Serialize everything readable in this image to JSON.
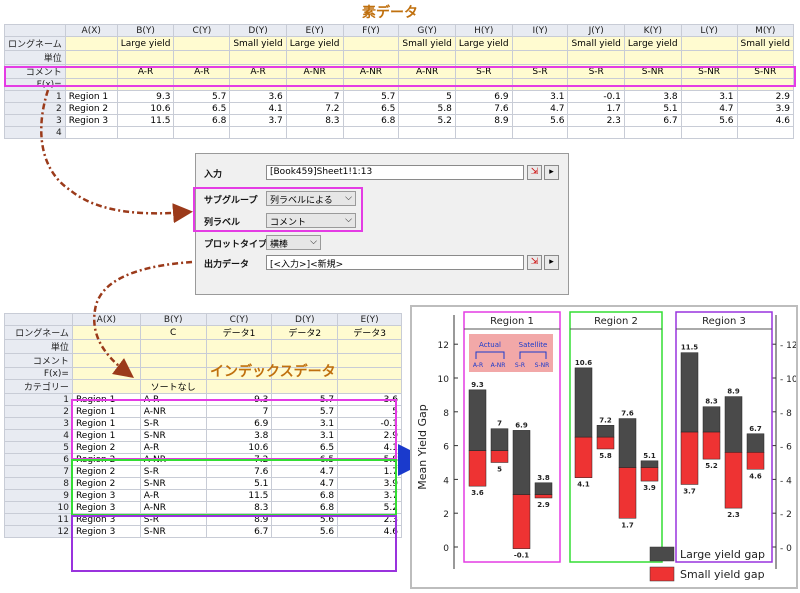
{
  "top_title": "素データ",
  "index_title": "インデックスデータ",
  "top_sheet": {
    "headers": [
      "",
      "A(X)",
      "B(Y)",
      "C(Y)",
      "D(Y)",
      "E(Y)",
      "F(Y)",
      "G(Y)",
      "H(Y)",
      "I(Y)",
      "J(Y)",
      "K(Y)",
      "L(Y)",
      "M(Y)"
    ],
    "longname": [
      "ロングネーム",
      "",
      "Large yield",
      "",
      "Small yield",
      "Large yield",
      "",
      "Small yield",
      "Large yield",
      "",
      "Small yield",
      "Large yield",
      "",
      "Small yield"
    ],
    "units": [
      "単位",
      "",
      "",
      "",
      "",
      "",
      "",
      "",
      "",
      "",
      "",
      "",
      "",
      ""
    ],
    "comments": [
      "コメント",
      "",
      "A-R",
      "A-R",
      "A-R",
      "A-NR",
      "A-NR",
      "A-NR",
      "S-R",
      "S-R",
      "S-R",
      "S-NR",
      "S-NR",
      "S-NR"
    ],
    "fx": [
      "F(x)=",
      "",
      "",
      "",
      "",
      "",
      "",
      "",
      "",
      "",
      "",
      "",
      "",
      ""
    ],
    "rows": [
      [
        "1",
        "Region 1",
        "9.3",
        "5.7",
        "3.6",
        "7",
        "5.7",
        "5",
        "6.9",
        "3.1",
        "-0.1",
        "3.8",
        "3.1",
        "2.9"
      ],
      [
        "2",
        "Region 2",
        "10.6",
        "6.5",
        "4.1",
        "7.2",
        "6.5",
        "5.8",
        "7.6",
        "4.7",
        "1.7",
        "5.1",
        "4.7",
        "3.9"
      ],
      [
        "3",
        "Region 3",
        "11.5",
        "6.8",
        "3.7",
        "8.3",
        "6.8",
        "5.2",
        "8.9",
        "5.6",
        "2.3",
        "6.7",
        "5.6",
        "4.6"
      ],
      [
        "4",
        "",
        "",
        "",
        "",
        "",
        "",
        "",
        "",
        "",
        "",
        "",
        "",
        ""
      ]
    ]
  },
  "dialog": {
    "input_label": "入力",
    "input_value": "[Book459]Sheet1!1:13",
    "subgroup_label": "サブグループ",
    "subgroup_value": "列ラベルによる",
    "collabel_label": "列ラベル",
    "collabel_value": "コメント",
    "plottype_label": "プロットタイプ",
    "plottype_value": "横棒",
    "output_label": "出力データ",
    "output_value": "[<入力>]<新規>",
    "arrow_btn": "▸"
  },
  "bottom_sheet": {
    "headers": [
      "",
      "A(X)",
      "B(Y)",
      "C(Y)",
      "D(Y)",
      "E(Y)"
    ],
    "longname": [
      "ロングネーム",
      "",
      "C",
      "データ1",
      "データ2",
      "データ3"
    ],
    "units": [
      "単位",
      "",
      "",
      "",
      "",
      ""
    ],
    "comments": [
      "コメント",
      "",
      "",
      "",
      "",
      ""
    ],
    "fx": [
      "F(x)=",
      "",
      "",
      "",
      "",
      ""
    ],
    "category": [
      "カテゴリー",
      "",
      "ソートなし",
      "",
      "",
      ""
    ],
    "rows": [
      [
        "1",
        "Region 1",
        "A-R",
        "9.3",
        "5.7",
        "3.6"
      ],
      [
        "2",
        "Region 1",
        "A-NR",
        "7",
        "5.7",
        "5"
      ],
      [
        "3",
        "Region 1",
        "S-R",
        "6.9",
        "3.1",
        "-0.1"
      ],
      [
        "4",
        "Region 1",
        "S-NR",
        "3.8",
        "3.1",
        "2.9"
      ],
      [
        "5",
        "Region 2",
        "A-R",
        "10.6",
        "6.5",
        "4.1"
      ],
      [
        "6",
        "Region 2",
        "A-NR",
        "7.2",
        "6.5",
        "5.8"
      ],
      [
        "7",
        "Region 2",
        "S-R",
        "7.6",
        "4.7",
        "1.7"
      ],
      [
        "8",
        "Region 2",
        "S-NR",
        "5.1",
        "4.7",
        "3.9"
      ],
      [
        "9",
        "Region 3",
        "A-R",
        "11.5",
        "6.8",
        "3.7"
      ],
      [
        "10",
        "Region 3",
        "A-NR",
        "8.3",
        "6.8",
        "5.2"
      ],
      [
        "11",
        "Region 3",
        "S-R",
        "8.9",
        "5.6",
        "2.3"
      ],
      [
        "12",
        "Region 3",
        "S-NR",
        "6.7",
        "5.6",
        "4.6"
      ]
    ]
  },
  "chart_data": {
    "type": "bar",
    "ylabel": "Mean Yield Gap",
    "ylim": [
      -1,
      13
    ],
    "yticks": [
      0,
      2,
      4,
      6,
      8,
      10,
      12
    ],
    "inset": {
      "actual": "Actual",
      "satellite": "Satellite",
      "labels": [
        "A-R",
        "A-NR",
        "S-R",
        "S-NR"
      ]
    },
    "groups": [
      {
        "name": "Region 1",
        "color": "#e43ce4",
        "bars": [
          {
            "top": 9.3,
            "mid": 5.7,
            "bot": 3.6
          },
          {
            "top": 7,
            "mid": 5.7,
            "bot": 5
          },
          {
            "top": 6.9,
            "mid": 3.1,
            "bot": -0.1
          },
          {
            "top": 3.8,
            "mid": 3.1,
            "bot": 2.9
          }
        ]
      },
      {
        "name": "Region 2",
        "color": "#33dd33",
        "bars": [
          {
            "top": 10.6,
            "mid": 6.5,
            "bot": 4.1
          },
          {
            "top": 7.2,
            "mid": 6.5,
            "bot": 5.8
          },
          {
            "top": 7.6,
            "mid": 4.7,
            "bot": 1.7
          },
          {
            "top": 5.1,
            "mid": 4.7,
            "bot": 3.9
          }
        ]
      },
      {
        "name": "Region 3",
        "color": "#9933dd",
        "bars": [
          {
            "top": 11.5,
            "mid": 6.8,
            "bot": 3.7
          },
          {
            "top": 8.3,
            "mid": 6.8,
            "bot": 5.2
          },
          {
            "top": 8.9,
            "mid": 5.6,
            "bot": 2.3
          },
          {
            "top": 6.7,
            "mid": 5.6,
            "bot": 4.6
          }
        ]
      }
    ],
    "legend": [
      {
        "label": "Large yield gap",
        "color": "#4a4a4a"
      },
      {
        "label": "Small yield gap",
        "color": "#ee3333"
      }
    ]
  },
  "colors": {
    "magenta": "#e43ce4",
    "green": "#33dd33",
    "purple": "#9933dd",
    "arrow": "#9b3a1a",
    "orange": "#c0700e"
  }
}
